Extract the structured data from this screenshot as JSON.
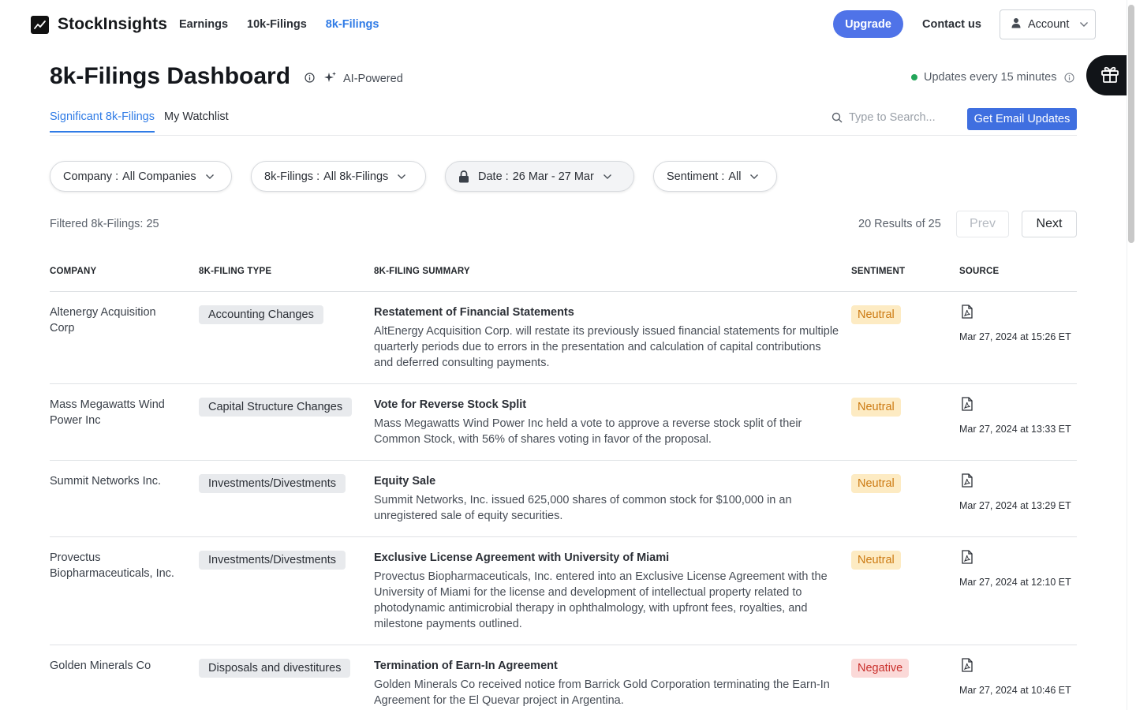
{
  "nav": {
    "brand": "StockInsights",
    "links": [
      "Earnings",
      "10k-Filings",
      "8k-Filings"
    ],
    "active_link": "8k-Filings",
    "upgrade_label": "Upgrade",
    "contact_label": "Contact us",
    "account_label": "Account"
  },
  "header": {
    "title": "8k-Filings Dashboard",
    "ai_label": "AI-Powered",
    "update_status": "Updates every 15 minutes"
  },
  "tabs": [
    {
      "label": "Significant 8k-Filings",
      "active": true
    },
    {
      "label": "My Watchlist",
      "active": false
    }
  ],
  "search": {
    "placeholder": "Type to Search..."
  },
  "email_button": "Get Email Updates",
  "filters": {
    "company": {
      "label": "Company :",
      "value": "All Companies"
    },
    "type": {
      "label": "8k-Filings :",
      "value": "All 8k-Filings"
    },
    "date": {
      "label": "Date :",
      "value": "26 Mar - 27 Mar"
    },
    "sentiment": {
      "label": "Sentiment :",
      "value": "All"
    }
  },
  "results": {
    "filtered_text": "Filtered 8k-Filings: 25",
    "range_text": "20 Results of 25",
    "prev_label": "Prev",
    "next_label": "Next"
  },
  "table": {
    "headers": [
      "COMPANY",
      "8K-FILING TYPE",
      "8K-FILING SUMMARY",
      "SENTIMENT",
      "SOURCE"
    ],
    "rows": [
      {
        "company": "Altenergy Acquisition Corp",
        "type": "Accounting Changes",
        "title": "Restatement of Financial Statements",
        "summary": "AltEnergy Acquisition Corp. will restate its previously issued financial statements for multiple quarterly periods due to errors in the presentation and calculation of capital contributions and deferred consulting payments.",
        "sentiment": "Neutral",
        "date": "Mar 27, 2024 at 15:26 ET"
      },
      {
        "company": "Mass Megawatts Wind Power Inc",
        "type": "Capital Structure Changes",
        "title": "Vote for Reverse Stock Split",
        "summary": "Mass Megawatts Wind Power Inc held a vote to approve a reverse stock split of their Common Stock, with 56% of shares voting in favor of the proposal.",
        "sentiment": "Neutral",
        "date": "Mar 27, 2024 at 13:33 ET"
      },
      {
        "company": "Summit Networks Inc.",
        "type": "Investments/Divestments",
        "title": "Equity Sale",
        "summary": "Summit Networks, Inc. issued 625,000 shares of common stock for $100,000 in an unregistered sale of equity securities.",
        "sentiment": "Neutral",
        "date": "Mar 27, 2024 at 13:29 ET"
      },
      {
        "company": "Provectus Biopharmaceuticals, Inc.",
        "type": "Investments/Divestments",
        "title": "Exclusive License Agreement with University of Miami",
        "summary": "Provectus Biopharmaceuticals, Inc. entered into an Exclusive License Agreement with the University of Miami for the license and development of intellectual property related to photodynamic antimicrobial therapy in ophthalmology, with upfront fees, royalties, and milestone payments outlined.",
        "sentiment": "Neutral",
        "date": "Mar 27, 2024 at 12:10 ET"
      },
      {
        "company": "Golden Minerals Co",
        "type": "Disposals and divestitures",
        "title": "Termination of Earn-In Agreement",
        "summary": "Golden Minerals Co received notice from Barrick Gold Corporation terminating the Earn-In Agreement for the El Quevar project in Argentina.",
        "sentiment": "Negative",
        "date": "Mar 27, 2024 at 10:46 ET"
      }
    ]
  },
  "colors": {
    "accent": "#2f7be6",
    "upgrade": "#4f73e8",
    "neutral_bg": "#fdebc3",
    "neutral_text": "#cc7a12",
    "negative_bg": "#fbd9d8",
    "negative_text": "#c9302c",
    "status_dot": "#22a559"
  },
  "icons": [
    "trend-logo-icon",
    "user-icon",
    "chevron-down-icon",
    "gift-icon",
    "info-icon",
    "sparkle-icon",
    "search-icon",
    "lock-icon",
    "pdf-file-icon"
  ]
}
